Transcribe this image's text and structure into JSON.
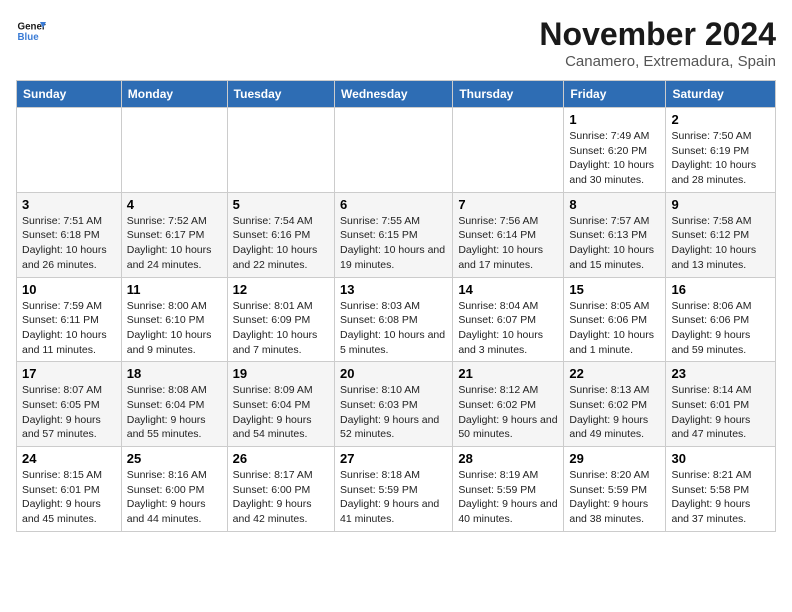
{
  "logo": {
    "line1": "General",
    "line2": "Blue"
  },
  "title": "November 2024",
  "subtitle": "Canamero, Extremadura, Spain",
  "days_of_week": [
    "Sunday",
    "Monday",
    "Tuesday",
    "Wednesday",
    "Thursday",
    "Friday",
    "Saturday"
  ],
  "weeks": [
    [
      {
        "day": "",
        "info": ""
      },
      {
        "day": "",
        "info": ""
      },
      {
        "day": "",
        "info": ""
      },
      {
        "day": "",
        "info": ""
      },
      {
        "day": "",
        "info": ""
      },
      {
        "day": "1",
        "info": "Sunrise: 7:49 AM\nSunset: 6:20 PM\nDaylight: 10 hours and 30 minutes."
      },
      {
        "day": "2",
        "info": "Sunrise: 7:50 AM\nSunset: 6:19 PM\nDaylight: 10 hours and 28 minutes."
      }
    ],
    [
      {
        "day": "3",
        "info": "Sunrise: 7:51 AM\nSunset: 6:18 PM\nDaylight: 10 hours and 26 minutes."
      },
      {
        "day": "4",
        "info": "Sunrise: 7:52 AM\nSunset: 6:17 PM\nDaylight: 10 hours and 24 minutes."
      },
      {
        "day": "5",
        "info": "Sunrise: 7:54 AM\nSunset: 6:16 PM\nDaylight: 10 hours and 22 minutes."
      },
      {
        "day": "6",
        "info": "Sunrise: 7:55 AM\nSunset: 6:15 PM\nDaylight: 10 hours and 19 minutes."
      },
      {
        "day": "7",
        "info": "Sunrise: 7:56 AM\nSunset: 6:14 PM\nDaylight: 10 hours and 17 minutes."
      },
      {
        "day": "8",
        "info": "Sunrise: 7:57 AM\nSunset: 6:13 PM\nDaylight: 10 hours and 15 minutes."
      },
      {
        "day": "9",
        "info": "Sunrise: 7:58 AM\nSunset: 6:12 PM\nDaylight: 10 hours and 13 minutes."
      }
    ],
    [
      {
        "day": "10",
        "info": "Sunrise: 7:59 AM\nSunset: 6:11 PM\nDaylight: 10 hours and 11 minutes."
      },
      {
        "day": "11",
        "info": "Sunrise: 8:00 AM\nSunset: 6:10 PM\nDaylight: 10 hours and 9 minutes."
      },
      {
        "day": "12",
        "info": "Sunrise: 8:01 AM\nSunset: 6:09 PM\nDaylight: 10 hours and 7 minutes."
      },
      {
        "day": "13",
        "info": "Sunrise: 8:03 AM\nSunset: 6:08 PM\nDaylight: 10 hours and 5 minutes."
      },
      {
        "day": "14",
        "info": "Sunrise: 8:04 AM\nSunset: 6:07 PM\nDaylight: 10 hours and 3 minutes."
      },
      {
        "day": "15",
        "info": "Sunrise: 8:05 AM\nSunset: 6:06 PM\nDaylight: 10 hours and 1 minute."
      },
      {
        "day": "16",
        "info": "Sunrise: 8:06 AM\nSunset: 6:06 PM\nDaylight: 9 hours and 59 minutes."
      }
    ],
    [
      {
        "day": "17",
        "info": "Sunrise: 8:07 AM\nSunset: 6:05 PM\nDaylight: 9 hours and 57 minutes."
      },
      {
        "day": "18",
        "info": "Sunrise: 8:08 AM\nSunset: 6:04 PM\nDaylight: 9 hours and 55 minutes."
      },
      {
        "day": "19",
        "info": "Sunrise: 8:09 AM\nSunset: 6:04 PM\nDaylight: 9 hours and 54 minutes."
      },
      {
        "day": "20",
        "info": "Sunrise: 8:10 AM\nSunset: 6:03 PM\nDaylight: 9 hours and 52 minutes."
      },
      {
        "day": "21",
        "info": "Sunrise: 8:12 AM\nSunset: 6:02 PM\nDaylight: 9 hours and 50 minutes."
      },
      {
        "day": "22",
        "info": "Sunrise: 8:13 AM\nSunset: 6:02 PM\nDaylight: 9 hours and 49 minutes."
      },
      {
        "day": "23",
        "info": "Sunrise: 8:14 AM\nSunset: 6:01 PM\nDaylight: 9 hours and 47 minutes."
      }
    ],
    [
      {
        "day": "24",
        "info": "Sunrise: 8:15 AM\nSunset: 6:01 PM\nDaylight: 9 hours and 45 minutes."
      },
      {
        "day": "25",
        "info": "Sunrise: 8:16 AM\nSunset: 6:00 PM\nDaylight: 9 hours and 44 minutes."
      },
      {
        "day": "26",
        "info": "Sunrise: 8:17 AM\nSunset: 6:00 PM\nDaylight: 9 hours and 42 minutes."
      },
      {
        "day": "27",
        "info": "Sunrise: 8:18 AM\nSunset: 5:59 PM\nDaylight: 9 hours and 41 minutes."
      },
      {
        "day": "28",
        "info": "Sunrise: 8:19 AM\nSunset: 5:59 PM\nDaylight: 9 hours and 40 minutes."
      },
      {
        "day": "29",
        "info": "Sunrise: 8:20 AM\nSunset: 5:59 PM\nDaylight: 9 hours and 38 minutes."
      },
      {
        "day": "30",
        "info": "Sunrise: 8:21 AM\nSunset: 5:58 PM\nDaylight: 9 hours and 37 minutes."
      }
    ]
  ]
}
